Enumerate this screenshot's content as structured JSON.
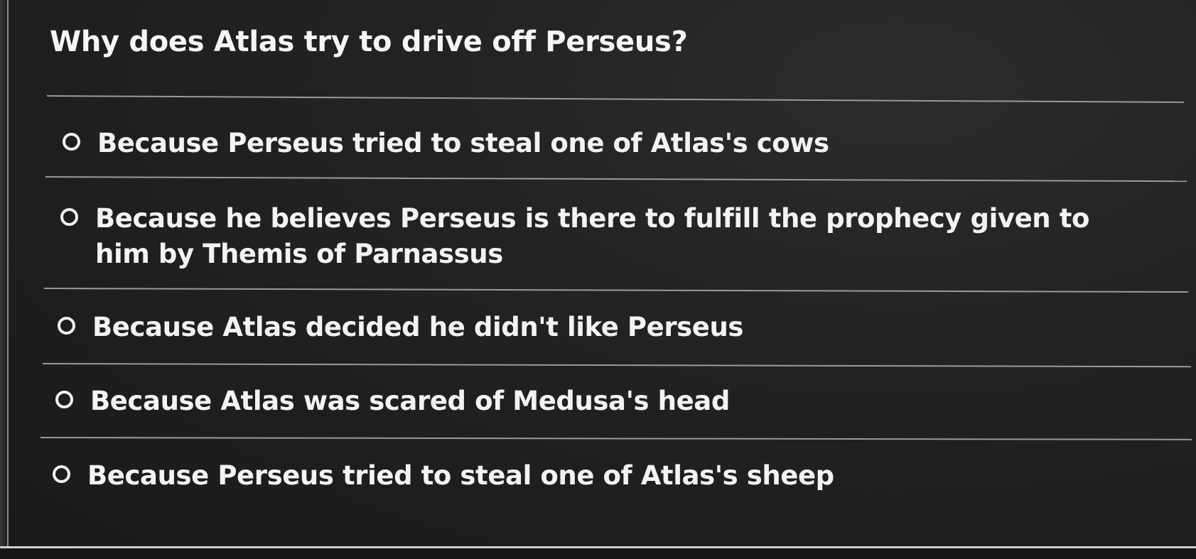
{
  "question": {
    "text": "Why does Atlas try to drive off Perseus?"
  },
  "options": [
    {
      "label": "Because Perseus tried to steal one of Atlas's cows",
      "selected": false
    },
    {
      "label": "Because he believes Perseus is there to fulfill the prophecy given to him by Themis of Parnassus",
      "selected": false
    },
    {
      "label": "Because Atlas decided he didn't like Perseus",
      "selected": false
    },
    {
      "label": "Because Atlas was scared of Medusa's head",
      "selected": false
    },
    {
      "label": "Because Perseus tried to steal one of Atlas's sheep",
      "selected": false
    }
  ],
  "colors": {
    "background": "#1e1e1e",
    "text": "#f3f3f3",
    "divider": "#9a9a9a",
    "radio_ring": "#f2f2f2"
  }
}
